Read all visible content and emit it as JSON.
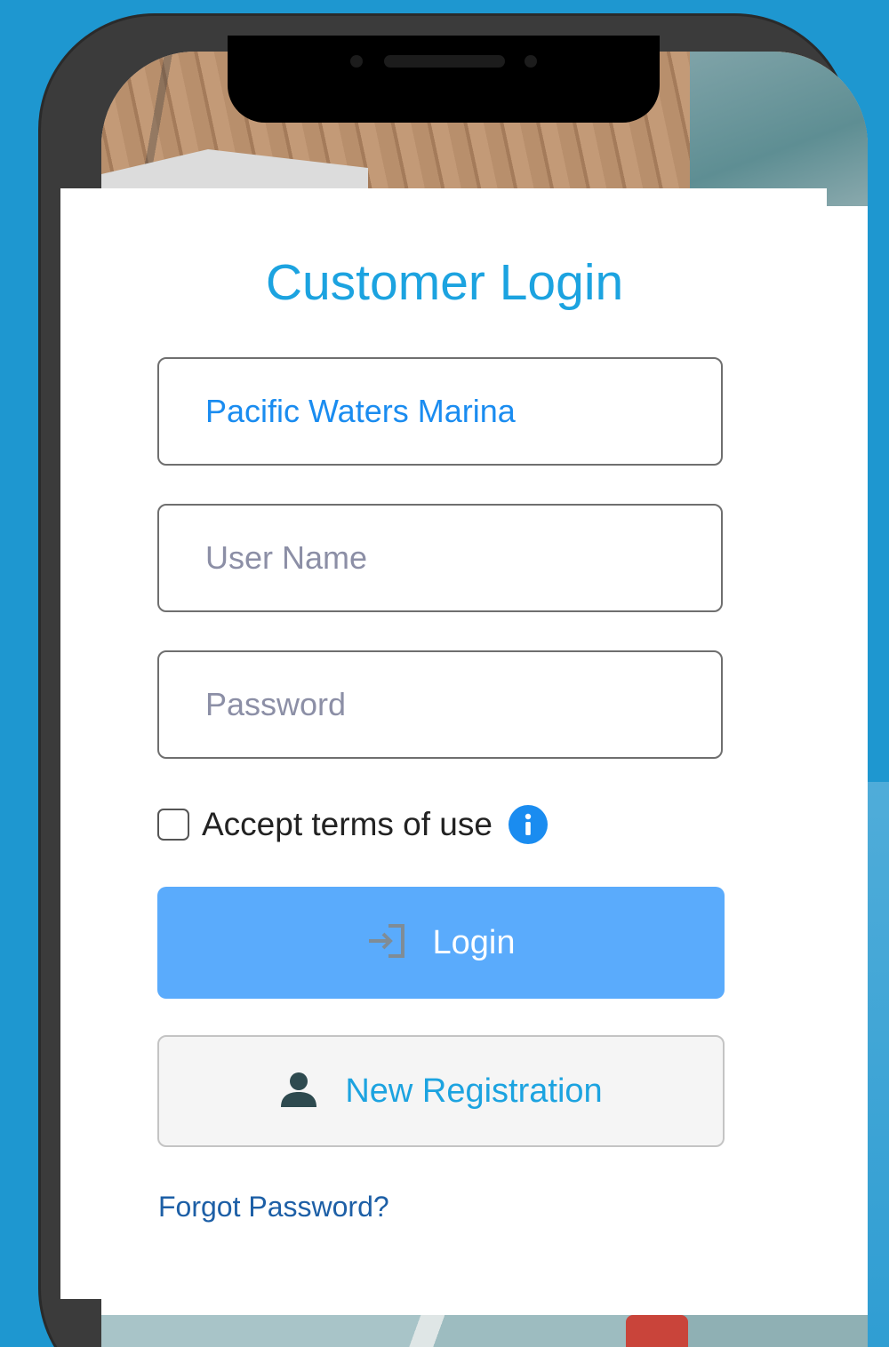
{
  "login_form": {
    "title": "Customer Login",
    "marina_field": {
      "value": "Pacific Waters Marina",
      "placeholder": ""
    },
    "username_field": {
      "value": "",
      "placeholder": "User Name"
    },
    "password_field": {
      "value": "",
      "placeholder": "Password"
    },
    "terms": {
      "label": "Accept terms of use",
      "checked": false,
      "info_icon": "info-icon"
    },
    "login_button": {
      "label": "Login",
      "icon": "login-arrow-icon"
    },
    "register_button": {
      "label": "New Registration",
      "icon": "user-icon"
    },
    "forgot_password_link": "Forgot Password?"
  },
  "colors": {
    "background": "#1e97d0",
    "title": "#1ca3e0",
    "login_button": "#5aabfc",
    "link": "#1d5fa6",
    "info_icon": "#1a8cf0"
  }
}
